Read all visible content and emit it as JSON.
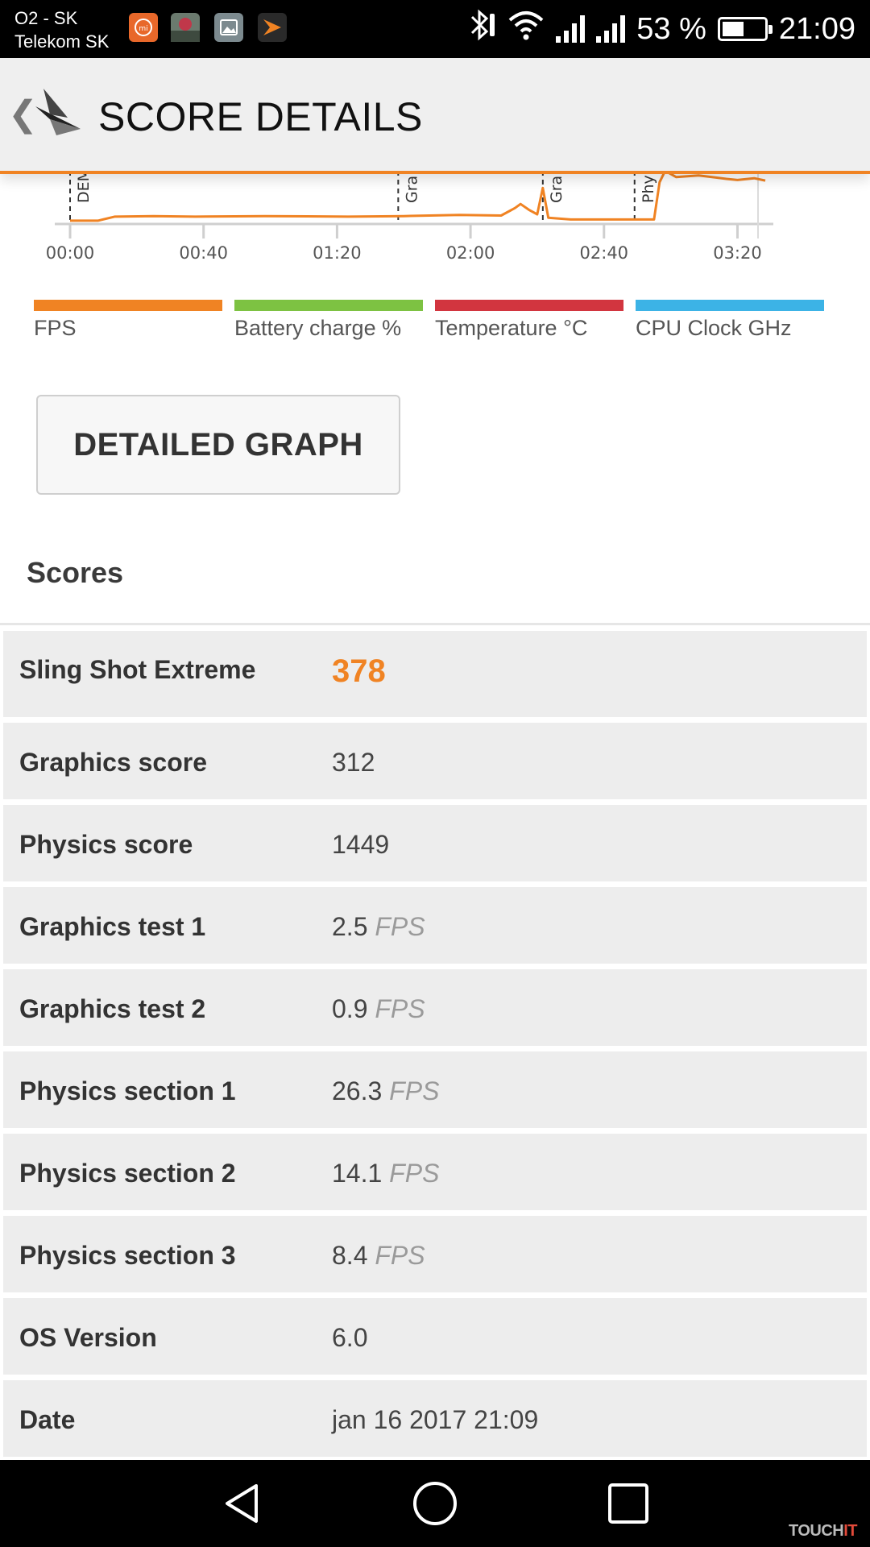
{
  "status_bar": {
    "carrier_line1": "O2 - SK",
    "carrier_line2": "Telekom SK",
    "battery_percent_text": "53 %",
    "battery_level": 0.53,
    "time": "21:09",
    "icons": [
      "mi-app-icon",
      "photo-thumbnail-icon",
      "gallery-icon",
      "3dmark-icon",
      "bluetooth-icon",
      "wifi-icon",
      "signal-icon",
      "signal-icon",
      "battery-icon"
    ]
  },
  "header": {
    "back_glyph": "❮",
    "title": "SCORE DETAILS",
    "accent_color": "#f08323"
  },
  "chart_data": {
    "type": "line",
    "x_ticks": [
      "00:00",
      "00:40",
      "01:20",
      "02:00",
      "02:40",
      "03:20"
    ],
    "xlim_seconds": [
      0,
      250
    ],
    "section_markers": [
      {
        "label": "DEM",
        "t": 0
      },
      {
        "label": "Gra",
        "t": 118
      },
      {
        "label": "Gra",
        "t": 170
      },
      {
        "label": "Phy",
        "t": 203
      }
    ],
    "series": [
      {
        "name": "FPS",
        "color": "#f08323",
        "points": [
          [
            0,
            3
          ],
          [
            10,
            3
          ],
          [
            16,
            10
          ],
          [
            30,
            11
          ],
          [
            45,
            10
          ],
          [
            70,
            11
          ],
          [
            100,
            10
          ],
          [
            120,
            11
          ],
          [
            140,
            13
          ],
          [
            155,
            12
          ],
          [
            160,
            25
          ],
          [
            162,
            32
          ],
          [
            165,
            22
          ],
          [
            168,
            14
          ],
          [
            170,
            60
          ],
          [
            172,
            8
          ],
          [
            180,
            5
          ],
          [
            195,
            5
          ],
          [
            200,
            5
          ],
          [
            210,
            5
          ],
          [
            212,
            70
          ],
          [
            214,
            90
          ],
          [
            218,
            79
          ],
          [
            226,
            82
          ],
          [
            236,
            76
          ],
          [
            240,
            74
          ],
          [
            246,
            77
          ],
          [
            250,
            73
          ]
        ]
      }
    ],
    "legend": [
      {
        "label": "FPS",
        "color": "#f08323"
      },
      {
        "label": "Battery charge %",
        "color": "#7dc242"
      },
      {
        "label": "Temperature °C",
        "color": "#d2353f"
      },
      {
        "label": "CPU Clock GHz",
        "color": "#3cb3e6"
      }
    ]
  },
  "detailed_graph_button": "DETAILED GRAPH",
  "scores": {
    "title": "Scores",
    "rows": [
      {
        "label": "Sling Shot Extreme",
        "value": "378",
        "unit": ""
      },
      {
        "label": "Graphics score",
        "value": "312",
        "unit": ""
      },
      {
        "label": "Physics score",
        "value": "1449",
        "unit": ""
      },
      {
        "label": "Graphics test 1",
        "value": "2.5",
        "unit": "FPS"
      },
      {
        "label": "Graphics test 2",
        "value": "0.9",
        "unit": "FPS"
      },
      {
        "label": "Physics section 1",
        "value": "26.3",
        "unit": "FPS"
      },
      {
        "label": "Physics section 2",
        "value": "14.1",
        "unit": "FPS"
      },
      {
        "label": "Physics section 3",
        "value": "8.4",
        "unit": "FPS"
      },
      {
        "label": "OS Version",
        "value": "6.0",
        "unit": ""
      },
      {
        "label": "Date",
        "value": "jan 16 2017 21:09",
        "unit": ""
      }
    ]
  },
  "navbar": {
    "buttons": [
      "back-nav-icon",
      "home-nav-icon",
      "recents-nav-icon"
    ],
    "watermark_a": "TOUCH",
    "watermark_b": "IT"
  }
}
